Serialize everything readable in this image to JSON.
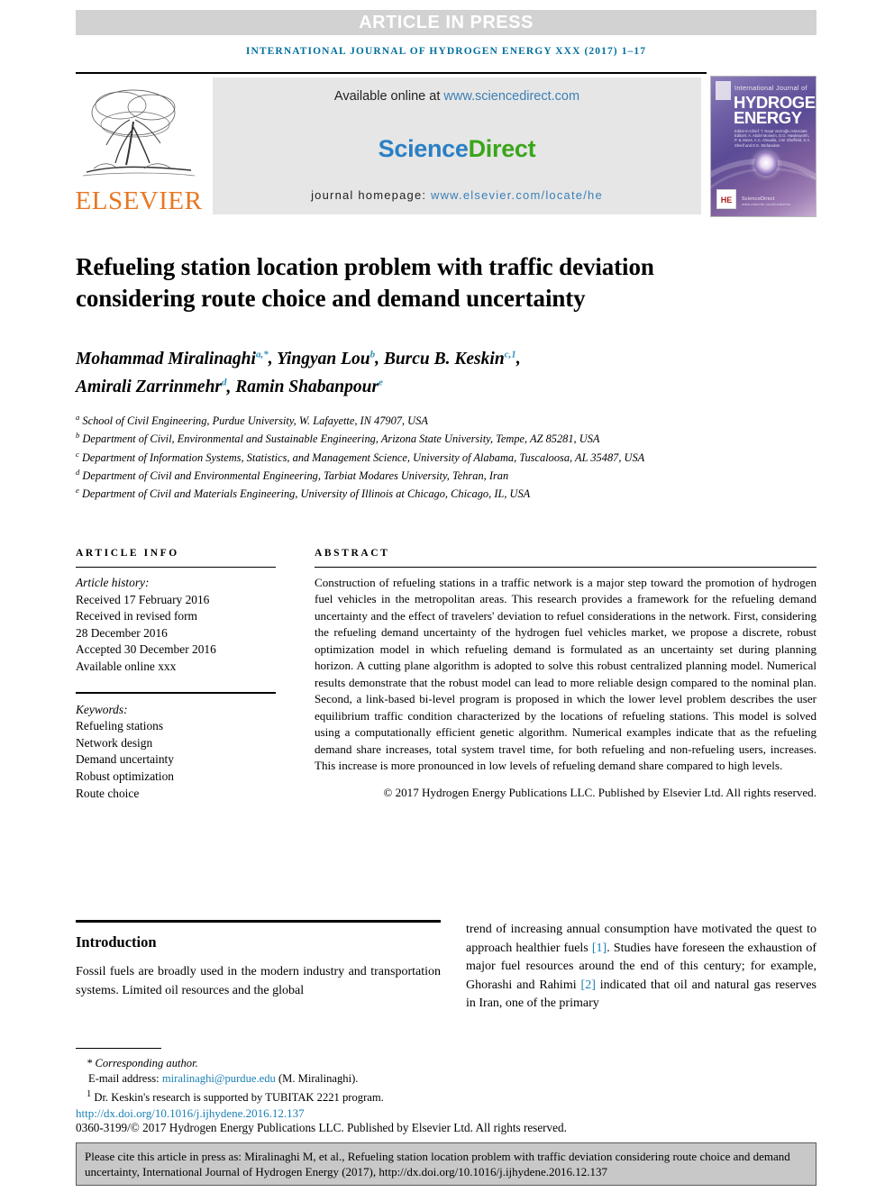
{
  "banner": {
    "label": "ARTICLE IN PRESS",
    "journal_line": "INTERNATIONAL JOURNAL OF HYDROGEN ENERGY XXX (2017) 1–17"
  },
  "masthead": {
    "publisher": "ELSEVIER",
    "available_prefix": "Available online at ",
    "available_url": "www.sciencedirect.com",
    "logo_first": "Science",
    "logo_second": "Direct",
    "homepage_prefix": "journal homepage: ",
    "homepage_url": "www.elsevier.com/locate/he"
  },
  "cover": {
    "kicker": "International Journal of",
    "line1": "HYDROGEN",
    "line2": "ENERGY",
    "editors": "Editor-in-Chief: T. Nejat Veziroğlu    Associate Editors: A. Abdel Moneim, D.G. Hawksworth, P. & Jones, A.C. Ahuadia, J.W. Sheffield, S.A. Sherif and E.E. Stefanakos",
    "he_mark": "HE",
    "sd_mark": "ScienceDirect",
    "sd_mark_sub": "www.elsevier.com/locate/he"
  },
  "article": {
    "title": "Refueling station location problem with traffic deviation considering route choice and demand uncertainty",
    "authors": [
      {
        "name": "Mohammad Miralinaghi",
        "marks": "a,*",
        "sep": ", "
      },
      {
        "name": "Yingyan Lou",
        "marks": "b",
        "sep": ", "
      },
      {
        "name": "Burcu B. Keskin",
        "marks": "c,1",
        "sep": ", "
      },
      {
        "name": "Amirali Zarrinmehr",
        "marks": "d",
        "sep": ", "
      },
      {
        "name": "Ramin Shabanpour",
        "marks": "e",
        "sep": ""
      }
    ],
    "affiliations": [
      {
        "mark": "a",
        "text": "School of Civil Engineering, Purdue University, W. Lafayette, IN 47907, USA"
      },
      {
        "mark": "b",
        "text": "Department of Civil, Environmental and Sustainable Engineering, Arizona State University, Tempe, AZ 85281, USA"
      },
      {
        "mark": "c",
        "text": "Department of Information Systems, Statistics, and Management Science, University of Alabama, Tuscaloosa, AL 35487, USA"
      },
      {
        "mark": "d",
        "text": "Department of Civil and Environmental Engineering, Tarbiat Modares University, Tehran, Iran"
      },
      {
        "mark": "e",
        "text": "Department of Civil and Materials Engineering, University of Illinois at Chicago, Chicago, IL, USA"
      }
    ]
  },
  "article_info": {
    "heading": "ARTICLE INFO",
    "history_label": "Article history:",
    "history": [
      "Received 17 February 2016",
      "Received in revised form",
      "28 December 2016",
      "Accepted 30 December 2016",
      "Available online xxx"
    ],
    "keywords_label": "Keywords:",
    "keywords": [
      "Refueling stations",
      "Network design",
      "Demand uncertainty",
      "Robust optimization",
      "Route choice"
    ]
  },
  "abstract": {
    "heading": "ABSTRACT",
    "body": "Construction of refueling stations in a traffic network is a major step toward the promotion of hydrogen fuel vehicles in the metropolitan areas. This research provides a framework for the refueling demand uncertainty and the effect of travelers' deviation to refuel considerations in the network. First, considering the refueling demand uncertainty of the hydrogen fuel vehicles market, we propose a discrete, robust optimization model in which refueling demand is formulated as an uncertainty set during planning horizon. A cutting plane algorithm is adopted to solve this robust centralized planning model. Numerical results demonstrate that the robust model can lead to more reliable design compared to the nominal plan. Second, a link-based bi-level program is proposed in which the lower level problem describes the user equilibrium traffic condition characterized by the locations of refueling stations. This model is solved using a computationally efficient genetic algorithm. Numerical examples indicate that as the refueling demand share increases, total system travel time, for both refueling and non-refueling users, increases. This increase is more pronounced in low levels of refueling demand share compared to high levels.",
    "copyright": "© 2017 Hydrogen Energy Publications LLC. Published by Elsevier Ltd. All rights reserved."
  },
  "introduction": {
    "heading": "Introduction",
    "col1": "Fossil fuels are broadly used in the modern industry and transportation systems. Limited oil resources and the global",
    "col2_part1": "trend of increasing annual consumption have motivated the quest to approach healthier fuels ",
    "col2_ref1": "[1]",
    "col2_part2": ". Studies have foreseen the exhaustion of major fuel resources around the end of this century; for example, Ghorashi and Rahimi ",
    "col2_ref2": "[2]",
    "col2_part3": " indicated that oil and natural gas reserves in Iran, one of the primary"
  },
  "footnotes": {
    "corresponding": "Corresponding author.",
    "email_label": "E-mail address: ",
    "email": "miralinaghi@purdue.edu",
    "email_suffix": " (M. Miralinaghi).",
    "note1_mark": "1",
    "note1": " Dr. Keskin's research is supported by TUBITAK 2221 program.",
    "doi": "http://dx.doi.org/10.1016/j.ijhydene.2016.12.137",
    "copyright": "0360-3199/© 2017 Hydrogen Energy Publications LLC. Published by Elsevier Ltd. All rights reserved."
  },
  "cite_box": {
    "text": "Please cite this article in press as: Miralinaghi M, et al., Refueling station location problem with traffic deviation considering route choice and demand uncertainty, International Journal of Hydrogen Energy (2017), http://dx.doi.org/10.1016/j.ijhydene.2016.12.137"
  },
  "colors": {
    "banner_bg": "#d2d2d2",
    "journal_blue": "#00709e",
    "elsevier_orange": "#e87722",
    "sciencedirect_blue": "#2a7fc4",
    "sciencedirect_green": "#3aa51a",
    "link_blue": "#1a7fb5",
    "cite_box_bg": "#c8c8c8"
  }
}
